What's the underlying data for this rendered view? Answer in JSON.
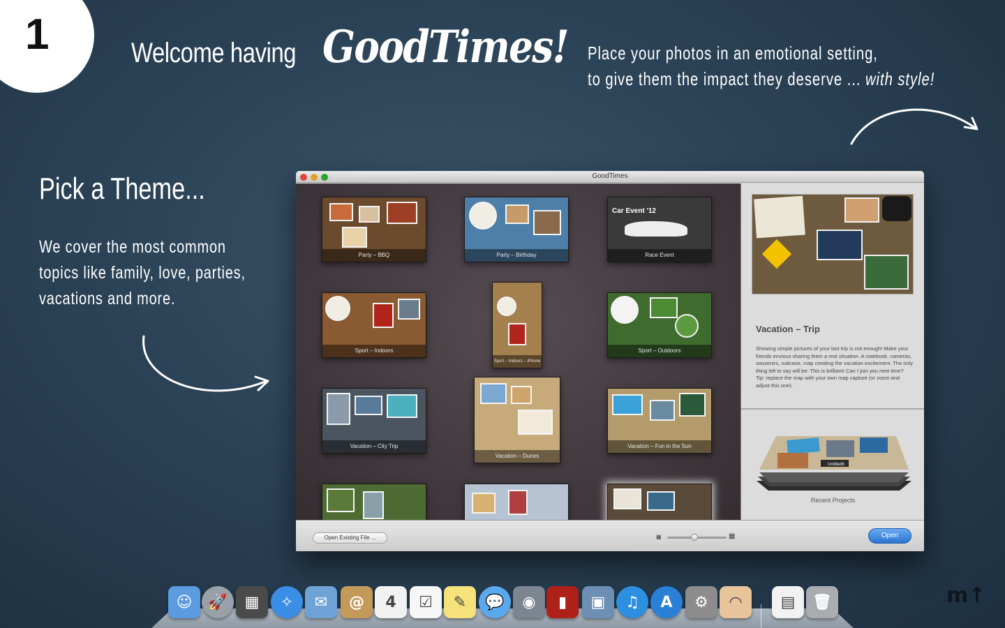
{
  "step_number": "1",
  "headline": {
    "prefix": "Welcome having",
    "brand": "GoodTimes!"
  },
  "tagline": {
    "line1": "Place your photos in an emotional setting,",
    "line2": "to give them the impact they deserve ...",
    "line2_emphasis": "with style!"
  },
  "section": {
    "title": "Pick a Theme...",
    "desc_line1": "We cover the most common",
    "desc_line2": "topics like family, love, parties,",
    "desc_line3": "vacations and more."
  },
  "window": {
    "title": "GoodTimes",
    "themes": [
      {
        "label": "Party – BBQ",
        "color": "#6b4a2e"
      },
      {
        "label": "Party – Birthday",
        "color": "#4d7fa8"
      },
      {
        "label": "Race Event",
        "color": "#3a3a3a",
        "overlay_text": "Car Event '12"
      },
      {
        "label": "Sport – Indoors",
        "color": "#8a5a32"
      },
      {
        "label": "Sport – Indoors – iPhone",
        "color": "#a5804f"
      },
      {
        "label": "Sport – Outdoors",
        "color": "#3f6b2e"
      },
      {
        "label": "Vacation – City Trip",
        "color": "#4a5560"
      },
      {
        "label": "Vacation – Dunes",
        "color": "#c7aa7a"
      },
      {
        "label": "Vacation – Fun in the Sun",
        "color": "#b39b6b"
      },
      {
        "label": "",
        "color": "#4e6b34"
      },
      {
        "label": "",
        "color": "#b6c3d2"
      },
      {
        "label": "",
        "color": "#5a4a3a"
      }
    ],
    "info": {
      "title": "Vacation – Trip",
      "description": "Showing simple pictures of your last trip is not enough! Make your friends envious sharing them a real situation. A notebook, cameras, souvenirs, suitcase, map creating the vacation excitement. The only thing left to say will be: This is brilliant! Can I join you next time?",
      "tip": "Tip: replace the map with your own map capture (or zoom and adjust this one)."
    },
    "recent": {
      "label": "Recent Projects",
      "project_name": "Untitled6"
    },
    "bottom": {
      "open_existing": "Open Existing File ...",
      "open": "Open",
      "zoom_level": 0.45
    }
  },
  "dock": [
    {
      "name": "finder-icon",
      "color": "#5b9be0",
      "glyph": "☺"
    },
    {
      "name": "launchpad-icon",
      "color": "#9aa0a8",
      "glyph": "🚀"
    },
    {
      "name": "mission-control-icon",
      "color": "#4a4a4a",
      "glyph": "▦"
    },
    {
      "name": "safari-icon",
      "color": "#3a8ee6",
      "glyph": "✧"
    },
    {
      "name": "mail-icon",
      "color": "#6fa3d8",
      "glyph": "✉"
    },
    {
      "name": "contacts-icon",
      "color": "#c49a5a",
      "glyph": "@"
    },
    {
      "name": "calendar-icon",
      "color": "#f2f2f2",
      "glyph": "4"
    },
    {
      "name": "reminders-icon",
      "color": "#f6f6f6",
      "glyph": "☑"
    },
    {
      "name": "notes-icon",
      "color": "#f5e27a",
      "glyph": "✎"
    },
    {
      "name": "messages-icon",
      "color": "#5aa8ee",
      "glyph": "💬"
    },
    {
      "name": "facetime-icon",
      "color": "#7c8590",
      "glyph": "◉"
    },
    {
      "name": "photo-booth-icon",
      "color": "#b0201a",
      "glyph": "▮"
    },
    {
      "name": "iphoto-icon",
      "color": "#6e8fb5",
      "glyph": "▣"
    },
    {
      "name": "itunes-icon",
      "color": "#2c8fe0",
      "glyph": "♫"
    },
    {
      "name": "app-store-icon",
      "color": "#2a7fd6",
      "glyph": "A"
    },
    {
      "name": "system-preferences-icon",
      "color": "#8c8c8c",
      "glyph": "⚙"
    },
    {
      "name": "goodtimes-app-icon",
      "color": "#e8c49a",
      "glyph": "◠"
    },
    {
      "name": "document-icon",
      "color": "#f2f2f2",
      "glyph": "▤"
    },
    {
      "name": "trash-icon",
      "color": "#a9adb2",
      "glyph": "🗑"
    }
  ]
}
